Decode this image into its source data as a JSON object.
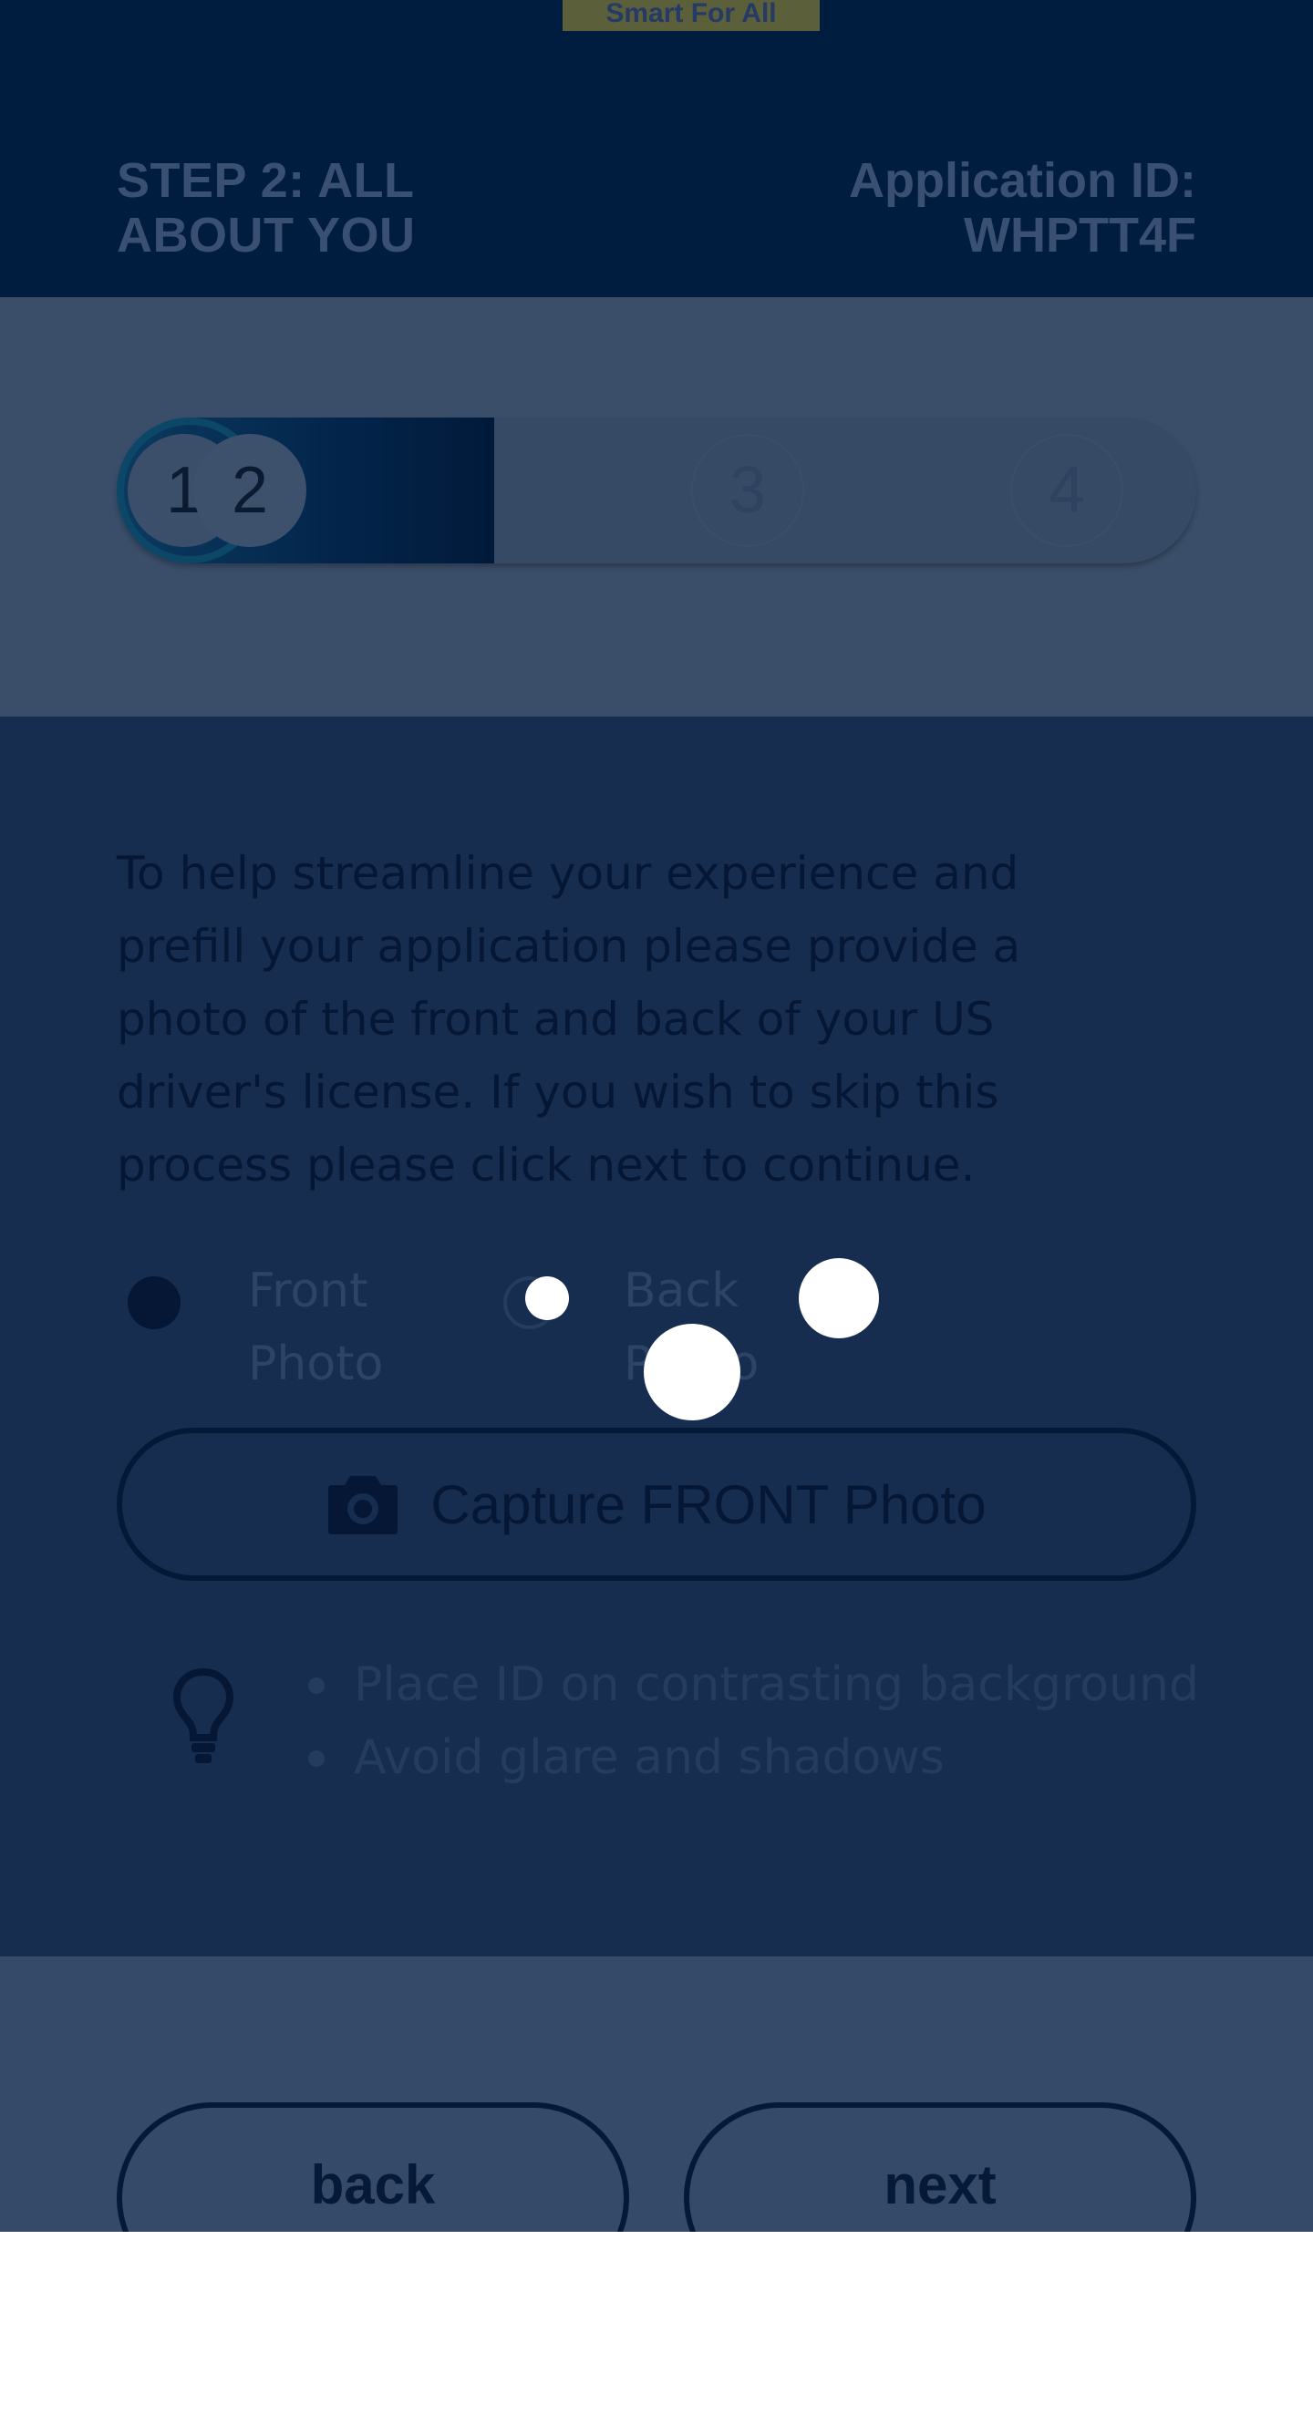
{
  "brand": {
    "tag": "Smart For All"
  },
  "header": {
    "step_title": "STEP 2: ALL ABOUT YOU",
    "application_id": "Application ID: WHPTT4F"
  },
  "progress": {
    "steps": [
      "1",
      "2",
      "3",
      "4"
    ],
    "current_step": 2,
    "completed_fraction": 0.25
  },
  "main": {
    "intro_text": "To help streamline your experience and prefill your application please provide a photo of the front and back of your US driver's license. If you wish to skip this process please click next to continue.",
    "photo_options": [
      {
        "label": "Front Photo",
        "selected": true
      },
      {
        "label": "Back Photo",
        "selected": false
      }
    ],
    "capture_button": "Capture FRONT Photo",
    "tips": [
      "Place ID on contrasting background",
      "Avoid glare and shadows"
    ]
  },
  "footer": {
    "back_label": "back",
    "next_label": "next"
  },
  "icons": {
    "camera": "camera-icon",
    "tip": "lightbulb-icon"
  },
  "colors": {
    "header_bg": "#001c3f",
    "accent": "#0b3a60",
    "overlay_text": "#051734"
  }
}
